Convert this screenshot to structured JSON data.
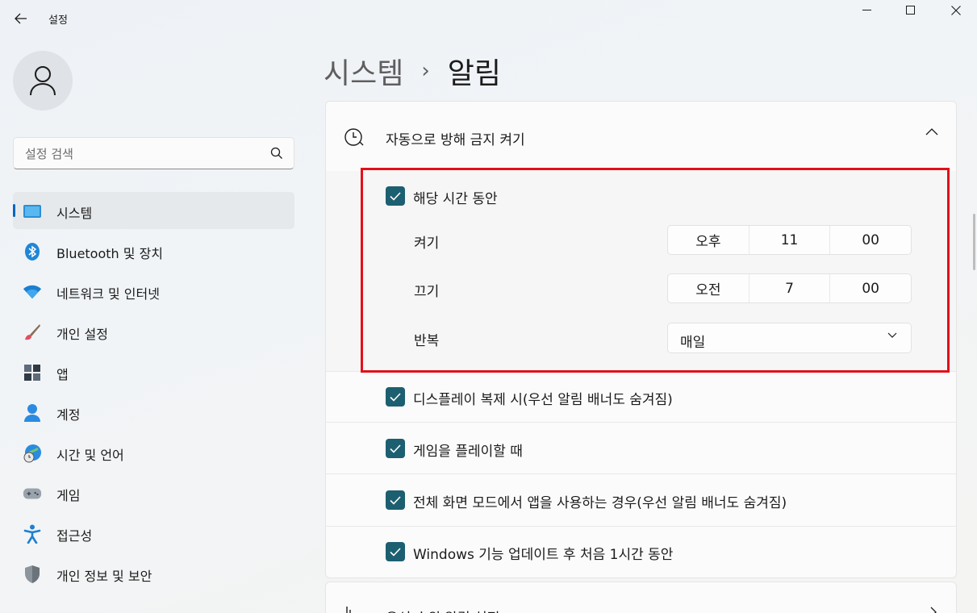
{
  "window": {
    "title": "설정",
    "controls": [
      "minimize",
      "maximize",
      "close"
    ]
  },
  "search": {
    "placeholder": "설정 검색"
  },
  "sidebar": {
    "items": [
      {
        "label": "시스템",
        "icon": "system-icon",
        "active": true
      },
      {
        "label": "Bluetooth 및 장치",
        "icon": "bluetooth-icon"
      },
      {
        "label": "네트워크 및 인터넷",
        "icon": "wifi-icon"
      },
      {
        "label": "개인 설정",
        "icon": "brush-icon"
      },
      {
        "label": "앱",
        "icon": "apps-icon"
      },
      {
        "label": "계정",
        "icon": "account-icon"
      },
      {
        "label": "시간 및 언어",
        "icon": "globe-clock-icon"
      },
      {
        "label": "게임",
        "icon": "gamepad-icon"
      },
      {
        "label": "접근성",
        "icon": "accessibility-icon"
      },
      {
        "label": "개인 정보 및 보안",
        "icon": "shield-icon"
      }
    ]
  },
  "breadcrumb": {
    "parent": "시스템",
    "separator": "›",
    "current": "알림"
  },
  "dnd": {
    "title": "자동으로 방해 금지 켜기",
    "schedule": {
      "label": "해당 시간 동안",
      "checked": true,
      "on": {
        "label": "켜기",
        "ampm": "오후",
        "hour": "11",
        "minute": "00"
      },
      "off": {
        "label": "끄기",
        "ampm": "오전",
        "hour": "7",
        "minute": "00"
      },
      "repeat": {
        "label": "반복",
        "value": "매일"
      }
    },
    "options": [
      {
        "label": "디스플레이 복제 시(우선 알림 배너도 숨겨짐)",
        "checked": true
      },
      {
        "label": "게임을 플레이할 때",
        "checked": true
      },
      {
        "label": "전체 화면 모드에서 앱을 사용하는 경우(우선 알림 배너도 숨겨짐)",
        "checked": true
      },
      {
        "label": "Windows 기능 업데이트 후 처음 1시간 동안",
        "checked": true
      }
    ]
  },
  "next_card": {
    "label": "우선 순위 알림 설정"
  },
  "colors": {
    "accent": "#1c5f70",
    "highlight": "#e2101a",
    "nav_indicator": "#0067c0"
  }
}
